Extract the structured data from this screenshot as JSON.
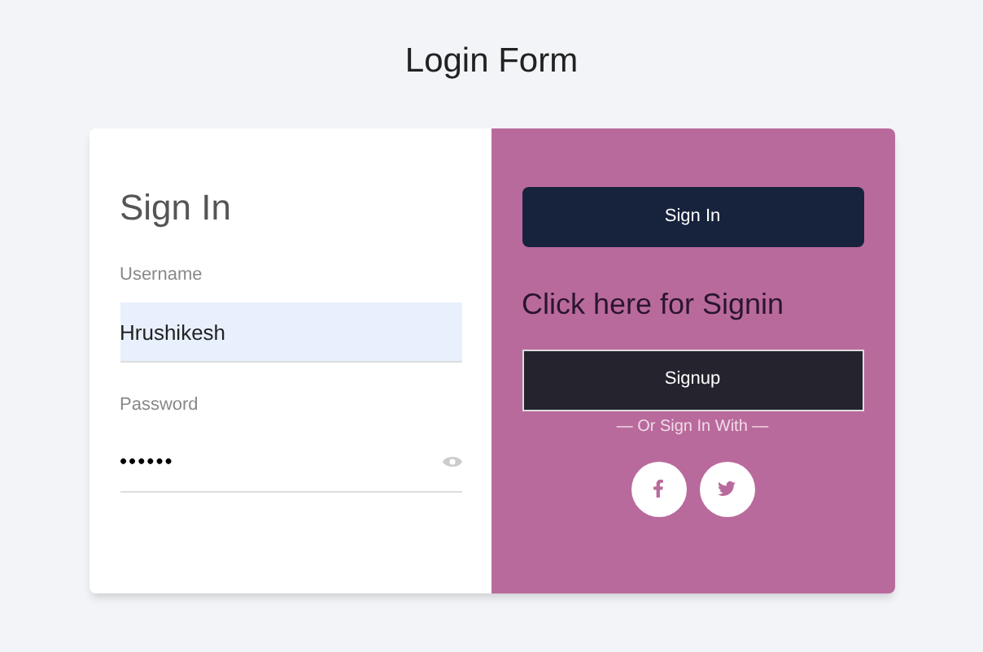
{
  "page_title": "Login Form",
  "sign_in_panel": {
    "heading": "Sign In",
    "username": {
      "label": "Username",
      "value": "Hrushikesh"
    },
    "password": {
      "label": "Password",
      "value": "••••••"
    }
  },
  "action_panel": {
    "sign_in_button": "Sign In",
    "prompt": "Click here for Signin",
    "signup_button": "Signup",
    "divider_text": "— Or Sign In With —",
    "social": [
      {
        "kind": "facebook"
      },
      {
        "kind": "twitter"
      }
    ]
  }
}
